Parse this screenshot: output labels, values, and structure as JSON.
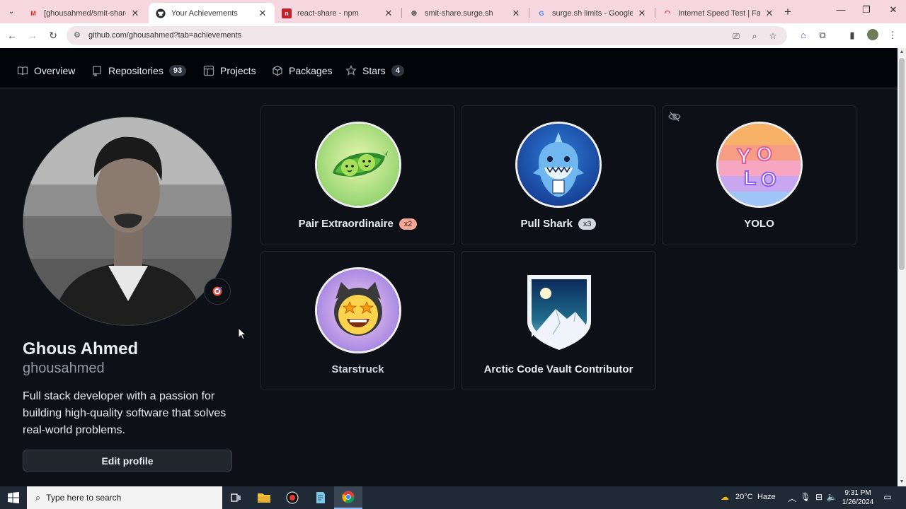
{
  "browser": {
    "tabs": [
      {
        "title": "[ghousahmed/smit-share] Re",
        "favicon": "gmail-icon",
        "active": false
      },
      {
        "title": "Your Achievements",
        "favicon": "github-icon",
        "active": true
      },
      {
        "title": "react-share - npm",
        "favicon": "npm-icon",
        "active": false
      },
      {
        "title": "smit-share.surge.sh",
        "favicon": "globe-icon",
        "active": false
      },
      {
        "title": "surge.sh limits - Google Sea",
        "favicon": "google-icon",
        "active": false
      },
      {
        "title": "Internet Speed Test | Fast.co",
        "favicon": "speed-icon",
        "active": false
      }
    ],
    "url": "github.com/ghousahmed?tab=achievements"
  },
  "nav": {
    "overview": "Overview",
    "repositories": "Repositories",
    "repositories_count": "93",
    "projects": "Projects",
    "packages": "Packages",
    "stars": "Stars",
    "stars_count": "4"
  },
  "profile": {
    "name": "Ghous Ahmed",
    "login": "ghousahmed",
    "bio": "Full stack developer with a passion for building high-quality software that solves real-world problems.",
    "edit_label": "Edit profile"
  },
  "achievements": [
    {
      "title": "Pair Extraordinaire",
      "tier": "x2",
      "tier_color": "#f2a798",
      "badge": "pea-pod-icon"
    },
    {
      "title": "Pull Shark",
      "tier": "x3",
      "tier_color": "#d0d7de",
      "badge": "shark-icon"
    },
    {
      "title": "YOLO",
      "tier": "",
      "badge": "yolo-icon",
      "hidden_from_profile": true
    },
    {
      "title": "Starstruck",
      "tier": "",
      "badge": "star-eyes-cat-icon"
    },
    {
      "title": "Arctic Code Vault Contributor",
      "tier": "",
      "badge": "arctic-vault-icon"
    }
  ],
  "taskbar": {
    "search_placeholder": "Type here to search",
    "weather": "20°C",
    "weather_desc": "Haze",
    "time": "9:31 PM",
    "date": "1/26/2024"
  },
  "colors": {
    "background": "#0d1117",
    "nav_background": "#010409",
    "text": "#e6edf3",
    "muted": "#9198a1",
    "tab_strip": "#f6d6df"
  }
}
